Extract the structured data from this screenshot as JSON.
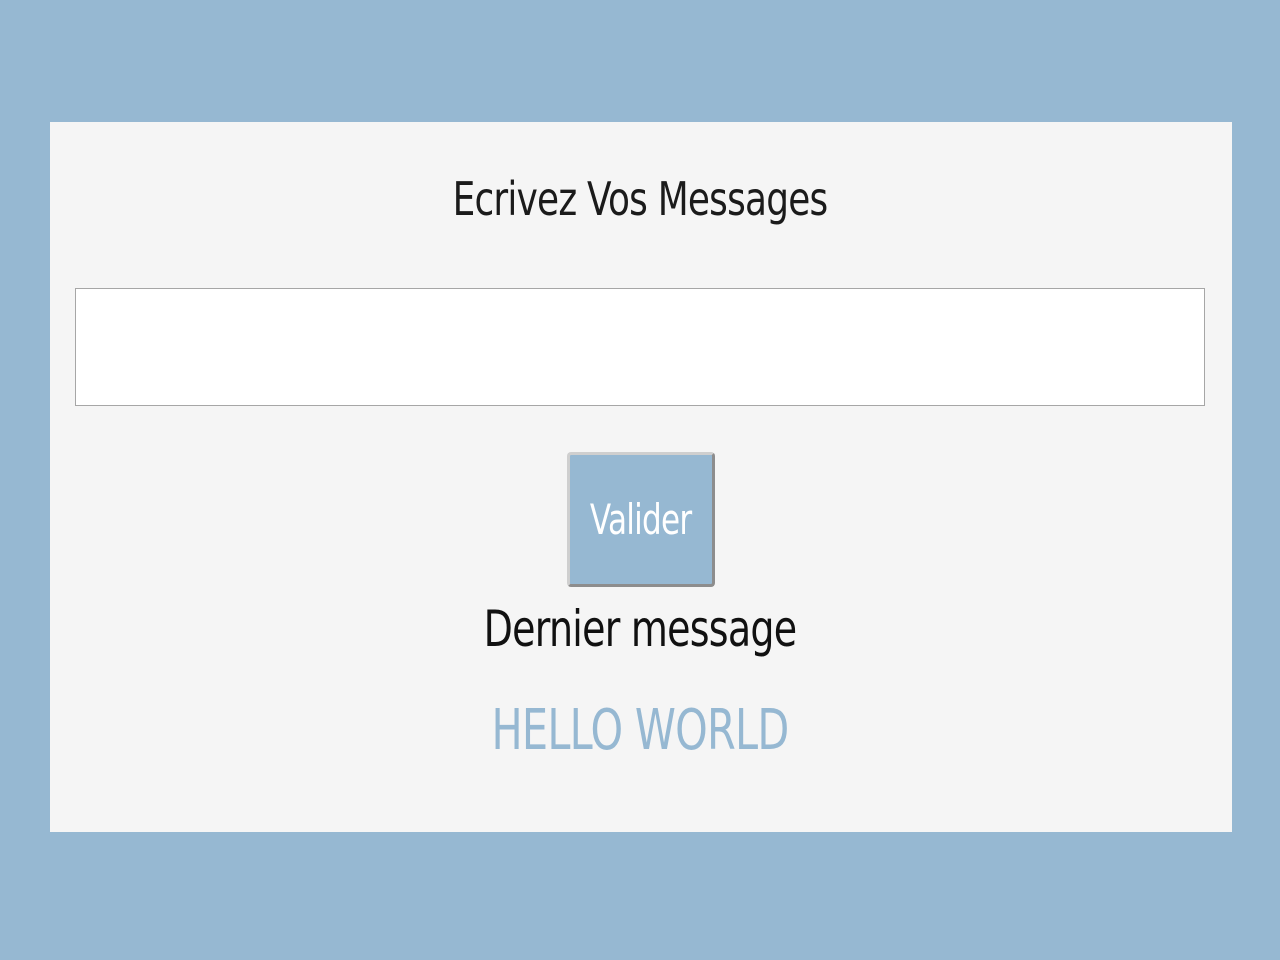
{
  "page": {
    "background_color": "#96b8d2",
    "card_color": "#f5f5f5"
  },
  "form": {
    "title": "Ecrivez Vos Messages",
    "message_input": {
      "value": "",
      "placeholder": ""
    },
    "submit_label": "Valider"
  },
  "last_message": {
    "label": "Dernier message",
    "value": "HELLO WORLD",
    "value_color": "#96b8d2"
  }
}
